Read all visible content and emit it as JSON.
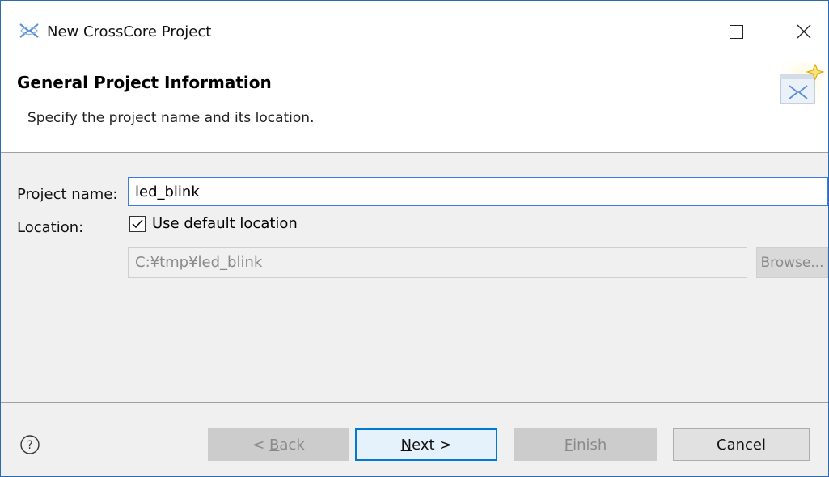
{
  "window": {
    "title": "New CrossCore Project"
  },
  "header": {
    "title": "General Project Information",
    "description": "Specify the project name and its location."
  },
  "form": {
    "project_name_label": "Project name:",
    "project_name_value": "led_blink",
    "location_label": "Location:",
    "use_default_label": "Use default location",
    "use_default_checked": true,
    "location_value": "C:¥tmp¥led_blink",
    "browse_label": "Browse..."
  },
  "buttons": {
    "back": {
      "prefix": "< ",
      "mnemonic": "B",
      "rest": "ack"
    },
    "next": {
      "mnemonic": "N",
      "rest": "ext >"
    },
    "finish": {
      "mnemonic": "F",
      "rest": "inish"
    },
    "cancel": "Cancel"
  },
  "icons": {
    "app": "crosscore-icon",
    "wizard": "wizard-banner-icon",
    "help": "help-icon"
  },
  "colors": {
    "accent": "#0078d7",
    "focus_border": "#3b7ddd"
  }
}
